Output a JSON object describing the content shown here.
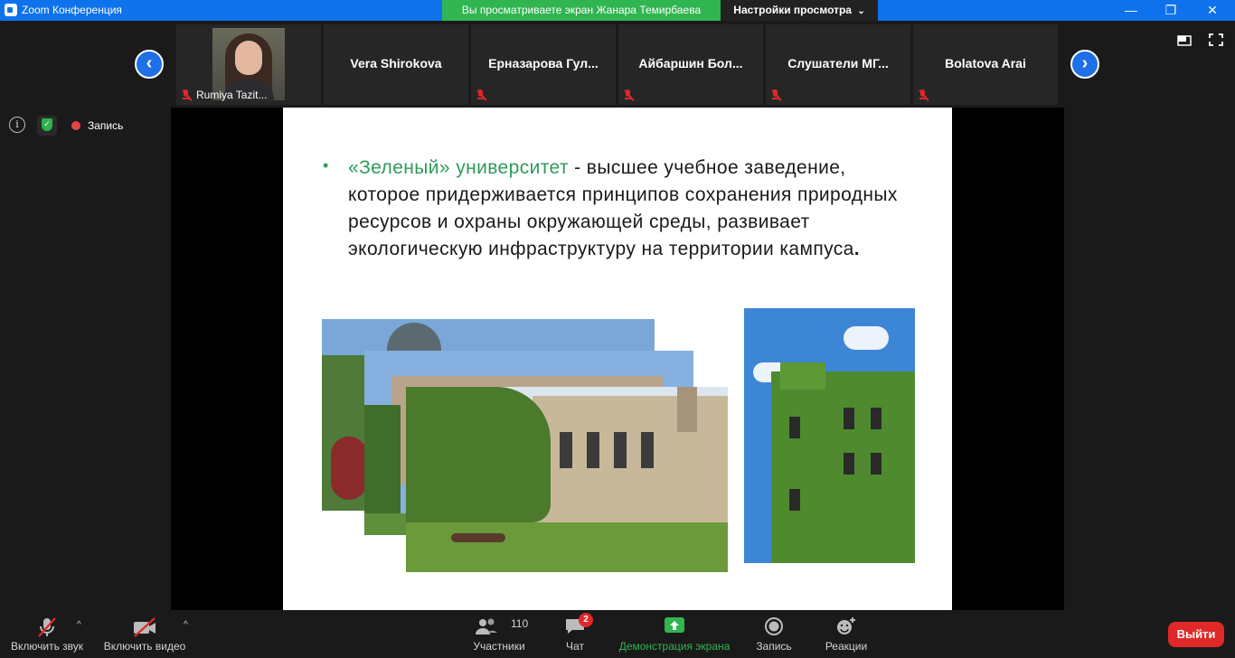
{
  "window": {
    "title": "Zoom Конференция",
    "share_notice": "Вы просматриваете экран Жанара Темирбаева",
    "view_options": "Настройки просмотра",
    "minimize": "—",
    "restore": "❐",
    "close": "✕"
  },
  "participants": [
    {
      "name": "Rumiya Tazit...",
      "video": true
    },
    {
      "name": "Vera Shirokova",
      "muted": false
    },
    {
      "name": "Ерназарова  Гул...",
      "muted": true
    },
    {
      "name": "Айбаршин  Бол...",
      "muted": true
    },
    {
      "name": "Слушатели  МГ...",
      "muted": true
    },
    {
      "name": "Bolatova Arai",
      "muted": true
    }
  ],
  "nav": {
    "prev": "‹",
    "next": "›"
  },
  "meeting_info": {
    "recording_label": "Запись"
  },
  "slide": {
    "bullet": "•",
    "term": "«Зеленый» университет",
    "definition": " - высшее учебное заведение, которое придерживается принципов сохранения природных ресурсов и охраны окружающей среды, развивает экологическую инфраструктуру на территории кампуса",
    "period": "."
  },
  "toolbar": {
    "audio_label": "Включить звук",
    "video_label": "Включить видео",
    "participants_label": "Участники",
    "participants_count": "110",
    "chat_label": "Чат",
    "chat_badge": "2",
    "share_label": "Демонстрация экрана",
    "record_label": "Запись",
    "reactions_label": "Реакции",
    "leave_label": "Выйти"
  },
  "colors": {
    "accent_blue": "#0e72ed",
    "share_green": "#30b550",
    "slide_green": "#2e9c5a",
    "danger_red": "#e02828"
  }
}
